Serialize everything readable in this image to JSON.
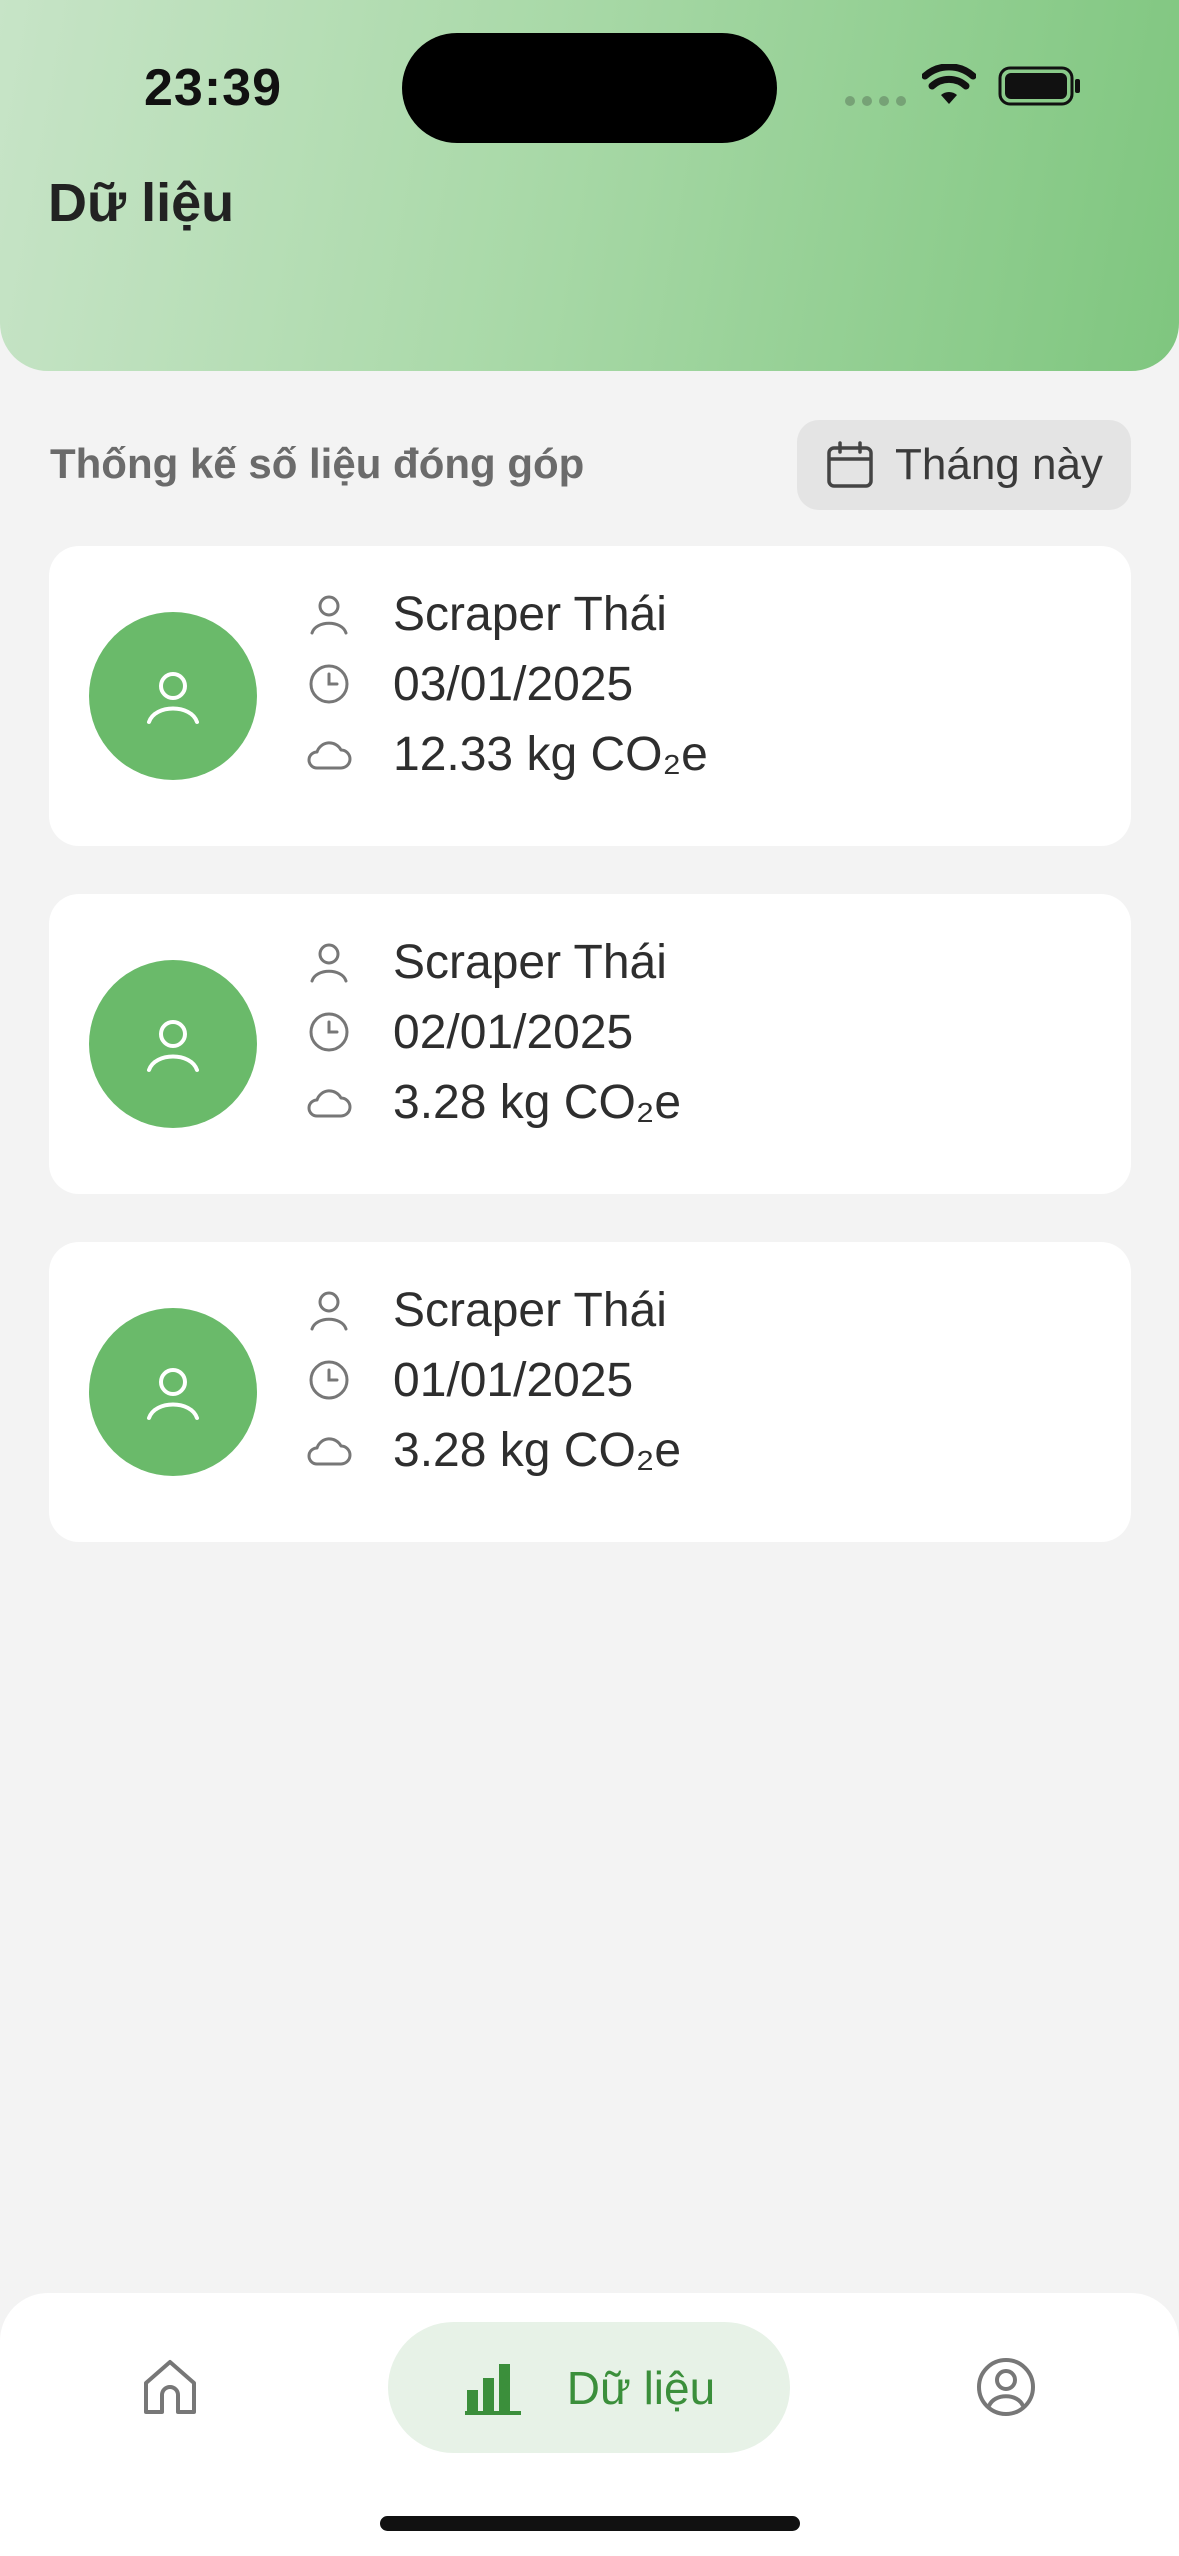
{
  "status_bar": {
    "time": "23:39"
  },
  "header": {
    "title": "Dữ liệu"
  },
  "section": {
    "title": "Thống kế số liệu đóng góp",
    "filter_label": "Tháng này"
  },
  "contributions": [
    {
      "name": "Scraper Thái",
      "date": "03/01/2025",
      "amount": "12.33 kg CO₂e"
    },
    {
      "name": "Scraper Thái",
      "date": "02/01/2025",
      "amount": "3.28 kg CO₂e"
    },
    {
      "name": "Scraper Thái",
      "date": "01/01/2025",
      "amount": "3.28 kg CO₂e"
    }
  ],
  "bottom_nav": {
    "items": [
      {
        "icon": "home-icon",
        "label": ""
      },
      {
        "icon": "bar-chart-icon",
        "label": "Dữ liệu",
        "active": true
      },
      {
        "icon": "profile-icon",
        "label": ""
      }
    ]
  },
  "colors": {
    "accent": "#6aba6a",
    "header_gradient_start": "#c7e4c7",
    "header_gradient_end": "#7fc67f",
    "active_nav_bg": "#e7f2e7",
    "active_nav_text": "#3b8f3b"
  }
}
